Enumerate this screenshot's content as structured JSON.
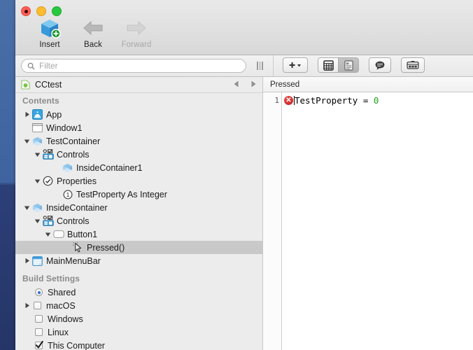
{
  "window": {
    "traffic_lights": [
      "close",
      "minimize",
      "zoom"
    ]
  },
  "toolbar": {
    "items": [
      {
        "label": "Insert",
        "icon": "insert-cube-icon",
        "disabled": false
      },
      {
        "label": "Back",
        "icon": "back-arrow-icon",
        "disabled": false
      },
      {
        "label": "Forward",
        "icon": "forward-arrow-icon",
        "disabled": true
      }
    ]
  },
  "filter": {
    "placeholder": "Filter",
    "value": "",
    "icon": "search-icon",
    "grip": "resize-grip-icon"
  },
  "right_tools": {
    "add_button": {
      "label": "+",
      "icon": "add-dropdown-icon"
    },
    "segmented": [
      {
        "icon": "grid-view-icon",
        "selected": false
      },
      {
        "icon": "list-view-icon",
        "selected": true
      }
    ],
    "comment_button": {
      "icon": "speech-bubble-icon"
    },
    "layout_button": {
      "icon": "toolbox-icon"
    }
  },
  "sidebar": {
    "project": {
      "name": "CCtest",
      "icon": "project-document-icon",
      "nav_back": "nav-back-arrow-icon",
      "nav_forward": "nav-forward-arrow-icon"
    },
    "sections": [
      {
        "title": "Contents",
        "rows": [
          {
            "label": "App",
            "indent": 0,
            "twisty": "collapsed",
            "icon": "app-icon",
            "selected": false
          },
          {
            "label": "Window1",
            "indent": 0,
            "twisty": "none",
            "icon": "window-icon",
            "selected": false
          },
          {
            "label": "TestContainer",
            "indent": 0,
            "twisty": "expanded",
            "icon": "container-icon",
            "selected": false
          },
          {
            "label": "Controls",
            "indent": 1,
            "twisty": "expanded",
            "icon": "controls-icon",
            "selected": false
          },
          {
            "label": "InsideContainer1",
            "indent": 2,
            "twisty": "none",
            "icon": "container-icon",
            "selected": false
          },
          {
            "label": "Properties",
            "indent": 1,
            "twisty": "expanded",
            "icon": "properties-icon",
            "selected": false
          },
          {
            "label": "TestProperty As Integer",
            "indent": 2,
            "twisty": "none",
            "icon": "property-icon",
            "selected": false
          },
          {
            "label": "InsideContainer",
            "indent": 0,
            "twisty": "expanded",
            "icon": "container-icon",
            "selected": false
          },
          {
            "label": "Controls",
            "indent": 1,
            "twisty": "expanded",
            "icon": "controls-icon",
            "selected": false
          },
          {
            "label": "Button1",
            "indent": 2,
            "twisty": "expanded",
            "icon": "button-icon",
            "selected": false
          },
          {
            "label": "Pressed()",
            "indent": 3,
            "twisty": "none",
            "icon": "event-cursor-icon",
            "selected": true
          },
          {
            "label": "MainMenuBar",
            "indent": 0,
            "twisty": "collapsed",
            "icon": "menubar-icon",
            "selected": false
          }
        ]
      },
      {
        "title": "Build Settings",
        "rows": [
          {
            "label": "Shared",
            "indent": 0,
            "twisty": "none",
            "icon": "radio-on",
            "selected": false
          },
          {
            "label": "macOS",
            "indent": 0,
            "twisty": "collapsed",
            "icon": "checkbox-off",
            "selected": false
          },
          {
            "label": "Windows",
            "indent": 0,
            "twisty": "none",
            "icon": "checkbox-off",
            "selected": false
          },
          {
            "label": "Linux",
            "indent": 0,
            "twisty": "none",
            "icon": "checkbox-off",
            "selected": false
          },
          {
            "label": "This Computer",
            "indent": 0,
            "twisty": "none",
            "icon": "checkbox-on",
            "selected": false
          }
        ]
      }
    ]
  },
  "editor": {
    "tab_label": "Pressed",
    "lines": [
      {
        "number": "1",
        "has_error": true,
        "error_glyph": "✕",
        "tokens": [
          {
            "text": "TestProperty",
            "kind": "id"
          },
          {
            "text": " ",
            "kind": "sp"
          },
          {
            "text": "=",
            "kind": "op"
          },
          {
            "text": " ",
            "kind": "sp"
          },
          {
            "text": "0",
            "kind": "num"
          }
        ]
      }
    ]
  },
  "colors": {
    "desktop_top": "#4a6ea6",
    "desktop_bottom": "#253567",
    "selection": "#c9c9c9",
    "sidebar_bg": "#ececec",
    "error_red": "#c62828",
    "number_green": "#1aa11a",
    "accent_blue": "#2a6fd6"
  }
}
